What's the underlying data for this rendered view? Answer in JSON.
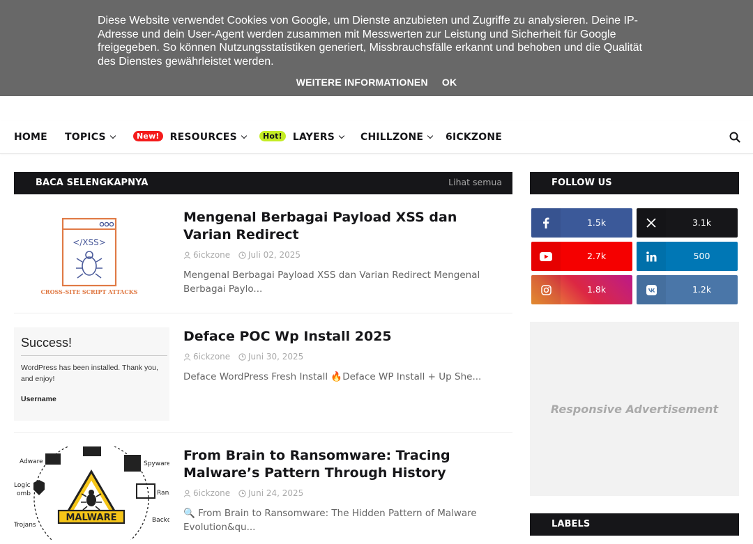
{
  "cookie": {
    "text": "Diese Website verwendet Cookies von Google, um Dienste anzubieten und Zugriffe zu analysieren. Deine IP-Adresse und dein User-Agent werden zusammen mit Messwerten zur Leistung und Sicherheit für Google freigegeben. So können Nutzungsstatistiken generiert, Missbrauchsfälle erkannt und behoben und die Qualität des Dienstes gewährleistet werden.",
    "more_label": "WEITERE INFORMATIONEN",
    "ok_label": "OK"
  },
  "nav": {
    "items": [
      {
        "label": "HOME"
      },
      {
        "label": "TOPICS"
      },
      {
        "label": "RESOURCES",
        "badge": "New!"
      },
      {
        "label": "LAYERS",
        "badge": "Hot!"
      },
      {
        "label": "CHILLZONE"
      },
      {
        "label": "6ICKZONE"
      }
    ]
  },
  "main": {
    "header_title": "BACA SELENGKAPNYA",
    "header_more": "Lihat semua",
    "posts": [
      {
        "title": "Mengenal Berbagai Payload XSS dan Varian Redirect",
        "author": "6ickzone",
        "date": "Juli 02, 2025",
        "snippet": "Mengenal Berbagai Payload XSS dan Varian Redirect Mengenal Berbagai Paylo...",
        "thumb_tag": "</XSS>",
        "thumb_caption": "CROSS-SITE SCRIPT ATTACKS"
      },
      {
        "title": "Deface POC Wp Install 2025",
        "author": "6ickzone",
        "date": "Juni 30, 2025",
        "snippet": "Deface WordPress Fresh Install 🔥Deface WP Install + Up She...",
        "thumb_title": "Success!",
        "thumb_text": "WordPress has been installed. Thank you, and enjoy!",
        "thumb_label": "Username"
      },
      {
        "title": "From Brain to Ransomware: Tracing Malware’s Pattern Through History",
        "author": "6ickzone",
        "date": "Juni 24, 2025",
        "snippet": "🔍 From Brain to Ransomware: The Hidden Pattern of Malware Evolution&qu...",
        "thumb_center": "MALWARE",
        "thumb_labels": [
          "Adware",
          "Spyware",
          "Logic",
          "omb",
          "Rans",
          "Trojans",
          "Backd"
        ]
      }
    ]
  },
  "sidebar": {
    "follow_title": "FOLLOW US",
    "social": [
      {
        "icon": "facebook-icon",
        "count": "1.5k",
        "color": "#3b5999"
      },
      {
        "icon": "x-twitter-icon",
        "count": "3.1k",
        "color": "#161619"
      },
      {
        "icon": "youtube-icon",
        "count": "2.7k",
        "color": "#f50000"
      },
      {
        "icon": "linkedin-icon",
        "count": "500",
        "color": "#0077b5"
      },
      {
        "icon": "instagram-icon",
        "count": "1.8k",
        "color": "#c13584"
      },
      {
        "icon": "vk-icon",
        "count": "1.2k",
        "color": "#4a76a8"
      }
    ],
    "ad_text": "Responsive Advertisement",
    "labels_title": "LABELS"
  }
}
